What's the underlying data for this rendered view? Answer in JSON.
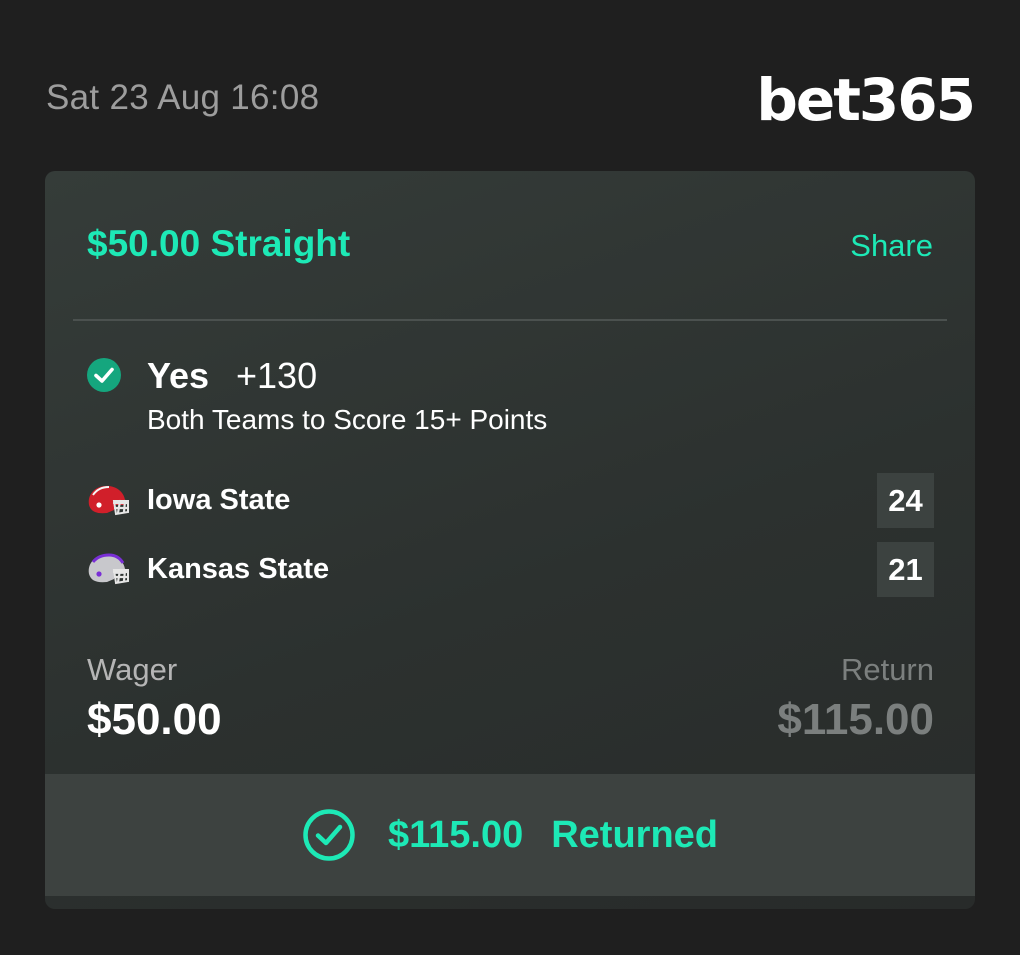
{
  "header": {
    "timestamp": "Sat 23 Aug 16:08",
    "brand": "bet365"
  },
  "bet": {
    "title": "$50.00 Straight",
    "share_label": "Share",
    "selection": {
      "name": "Yes",
      "odds": "+130",
      "market": "Both Teams to Score 15+ Points",
      "status_icon": "check-circle-icon"
    },
    "teams": [
      {
        "name": "Iowa State",
        "score": "24",
        "helmet_icon": "helmet-red-icon"
      },
      {
        "name": "Kansas State",
        "score": "21",
        "helmet_icon": "helmet-purple-icon"
      }
    ],
    "wager_label": "Wager",
    "wager_value": "$50.00",
    "return_label": "Return",
    "return_value": "$115.00"
  },
  "status": {
    "amount": "$115.00",
    "text": "Returned",
    "icon": "check-circle-outline-icon"
  },
  "colors": {
    "accent": "#1de9b6",
    "background": "#1f1f1f",
    "card": "#2f3432",
    "check": "#15a67e"
  }
}
